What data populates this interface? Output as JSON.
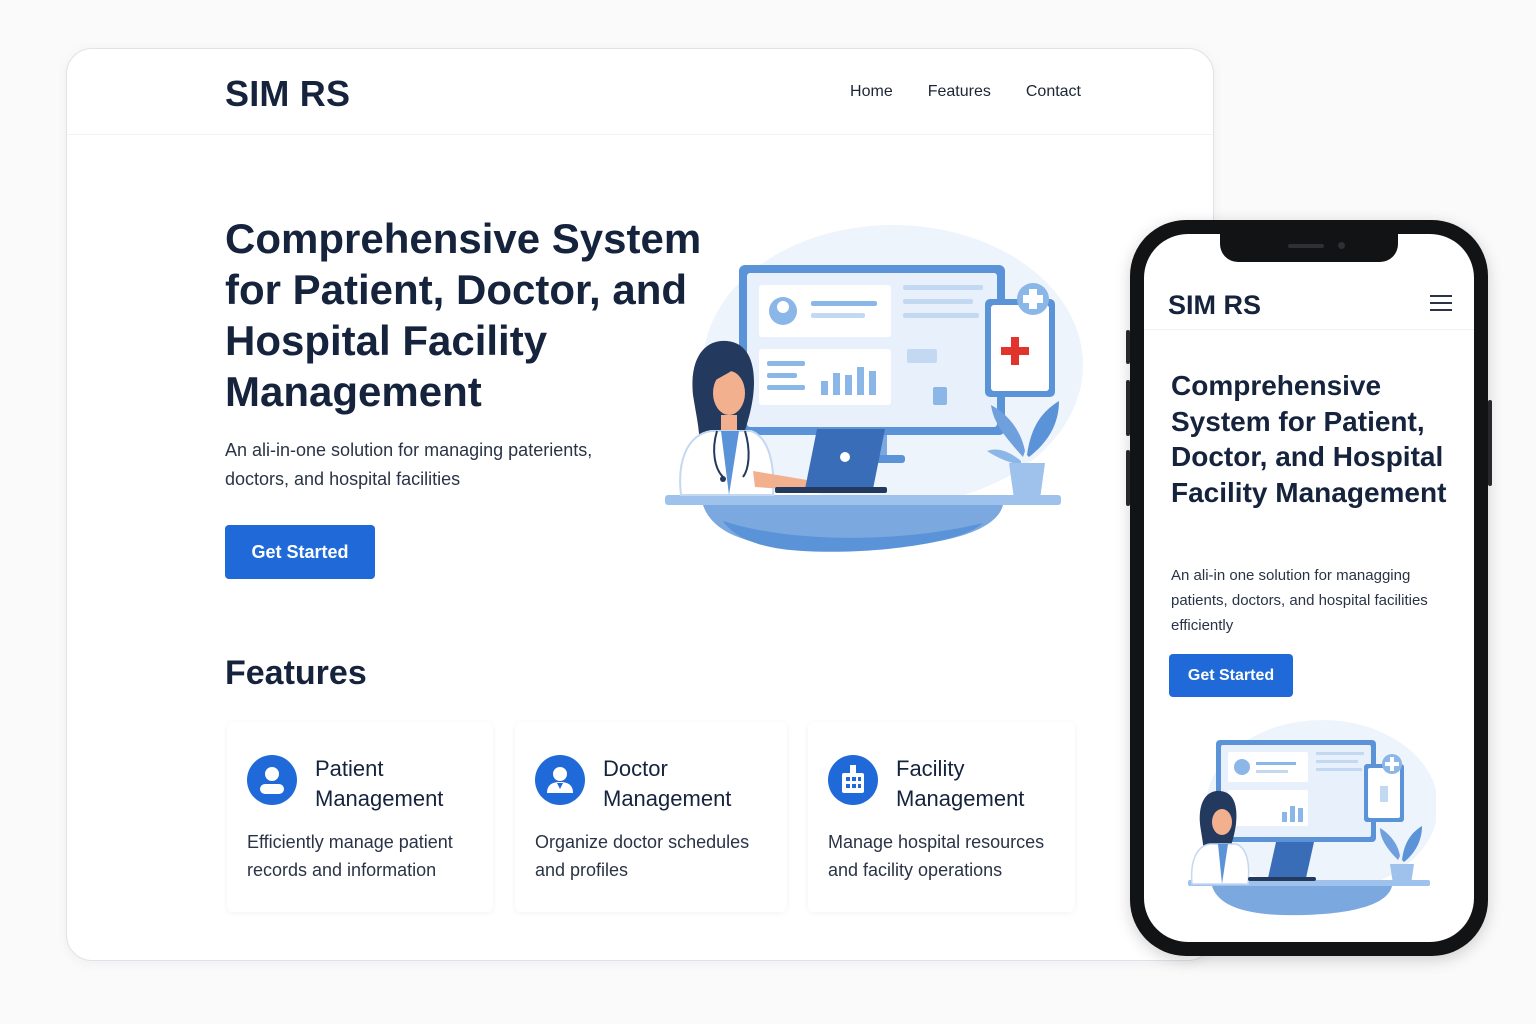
{
  "desktop": {
    "header": {
      "logo": "SIM RS",
      "nav": [
        "Home",
        "Features",
        "Contact"
      ]
    },
    "hero": {
      "title": "Comprehensive System for Patient, Doctor, and Hospital Facility Management",
      "subtitle": "An ali-in-one solution for managing paterients, doctors, and hospital facilities",
      "cta_label": "Get Started"
    },
    "features": {
      "title": "Features",
      "cards": [
        {
          "title": "Patient Management",
          "description": "Efficiently manage patient records and information",
          "icon": "user-icon"
        },
        {
          "title": "Doctor Management",
          "description": "Organize doctor schedules and profiles",
          "icon": "doctor-icon"
        },
        {
          "title": "Facility Management",
          "description": "Manage hospital resources and facility operations",
          "icon": "hospital-building-icon"
        }
      ]
    }
  },
  "mobile": {
    "header": {
      "logo": "SIM RS",
      "menu_icon": "hamburger-menu-icon"
    },
    "hero": {
      "title": "Comprehensive System for Patient, Doctor, and Hospital Facility Management",
      "subtitle": "An ali-in one solution for managging patients, doctors, and hospital facilities efficiently",
      "cta_label": "Get Started"
    }
  },
  "colors": {
    "primary": "#1f6ad8",
    "heading": "#15233c",
    "text": "#2a3446",
    "illustration_light": "#d6e6f8",
    "illustration_mid": "#8bb6e8",
    "illustration_dark": "#3a6db8",
    "cross_red": "#e0342c"
  }
}
